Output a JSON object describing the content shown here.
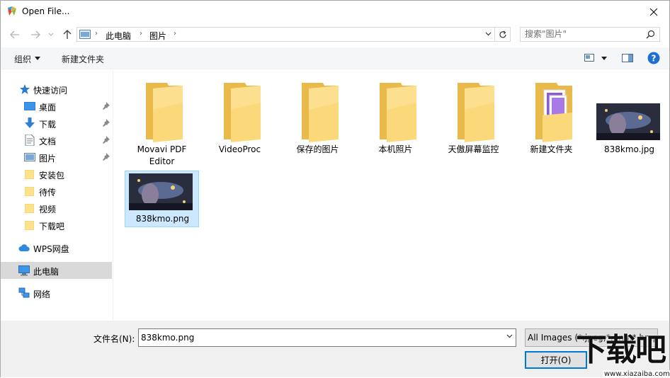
{
  "window": {
    "title": "Open File..."
  },
  "breadcrumb": {
    "items": [
      "此电脑",
      "图片"
    ]
  },
  "search": {
    "placeholder": "搜索\"图片\""
  },
  "toolbar": {
    "organize": "组织",
    "new_folder": "新建文件夹"
  },
  "sidebar": {
    "quick_access": "快速访问",
    "quick_items": [
      {
        "label": "桌面",
        "pinned": true
      },
      {
        "label": "下载",
        "pinned": true
      },
      {
        "label": "文档",
        "pinned": true
      },
      {
        "label": "图片",
        "pinned": true
      },
      {
        "label": "安装包",
        "pinned": false
      },
      {
        "label": "待传",
        "pinned": false
      },
      {
        "label": "视频",
        "pinned": false
      },
      {
        "label": "下载吧",
        "pinned": false
      }
    ],
    "wps": "WPS网盘",
    "this_pc": "此电脑",
    "network": "网络"
  },
  "files": [
    {
      "name_line1": "Movavi PDF",
      "name_line2": "Editor",
      "type": "folder"
    },
    {
      "name": "VideoProc",
      "type": "folder"
    },
    {
      "name": "保存的图片",
      "type": "folder"
    },
    {
      "name": "本机照片",
      "type": "folder"
    },
    {
      "name": "天傲屏幕监控",
      "type": "folder"
    },
    {
      "name": "新建文件夹",
      "type": "folder-purple"
    },
    {
      "name": "838kmo.jpg",
      "type": "image"
    },
    {
      "name": "838kmo.png",
      "type": "image",
      "selected": true
    }
  ],
  "bottom": {
    "filename_label": "文件名(N):",
    "filename_value": "838kmo.png",
    "filetype_value": "All Images (*.jpeg;*.png;*.bmp",
    "open_button": "打开(O)"
  },
  "watermark": {
    "text": "下载吧",
    "url": "www.xiazaiba.com"
  },
  "colors": {
    "accent": "#0078d7",
    "selection": "#cce8ff",
    "folder": "#f8d775"
  }
}
